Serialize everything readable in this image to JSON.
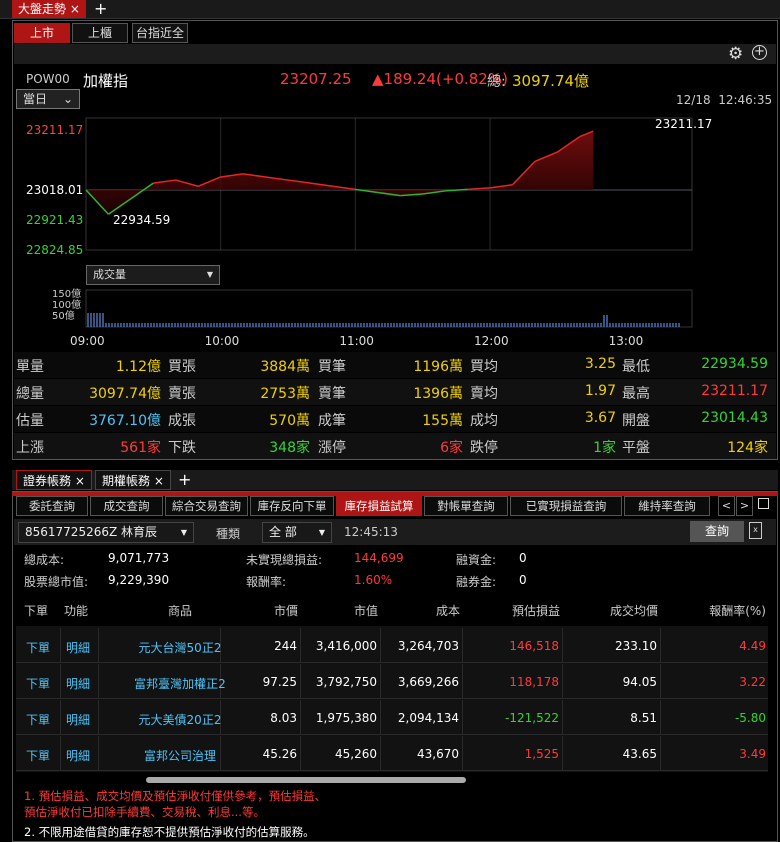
{
  "top_tab": {
    "label": "大盤走勢",
    "close": "×",
    "add": "+"
  },
  "market_tabs": [
    "上市",
    "上櫃",
    "台指近全"
  ],
  "index": {
    "code": "POW00",
    "name": "加權指",
    "price": "23207.25",
    "change": "▲189.24(+0.82%)",
    "total_label": "總:",
    "total": "3097.74億",
    "period": "當日",
    "datetime": "12/18  12:46:35"
  },
  "chart_data": {
    "type": "line",
    "y_ticks": [
      "23211.17",
      "23018.01",
      "22921.43",
      "22824.85"
    ],
    "x_ticks": [
      "09:00",
      "10:00",
      "11:00",
      "12:00",
      "13:00"
    ],
    "high_label": "23211.17",
    "low_label": "22934.59",
    "ref": "23018.01",
    "ylim": [
      22824.85,
      23211.17
    ],
    "x": [
      "09:00",
      "09:10",
      "09:20",
      "09:30",
      "09:40",
      "09:50",
      "10:00",
      "10:10",
      "10:20",
      "10:30",
      "10:40",
      "10:50",
      "11:00",
      "11:10",
      "11:20",
      "11:30",
      "11:40",
      "11:50",
      "12:00",
      "12:10",
      "12:20",
      "12:30",
      "12:40",
      "12:46"
    ],
    "values": [
      23018.01,
      22940,
      22990,
      23040,
      23050,
      23030,
      23060,
      23070,
      23060,
      23050,
      23040,
      23030,
      23020,
      23010,
      23000,
      23005,
      23015,
      23020,
      23025,
      23035,
      23110,
      23140,
      23190,
      23207.25
    ],
    "volume_select": "成交量",
    "volume_ticks": [
      "150億",
      "100億",
      "50億"
    ]
  },
  "stats": [
    [
      {
        "l": "單量",
        "v": "1.12億",
        "c": "yellow"
      },
      {
        "l": "買張",
        "v": "3884萬",
        "c": "yellow"
      },
      {
        "l": "買筆",
        "v": "1196萬",
        "c": "yellow"
      },
      {
        "l": "買均",
        "v": "3.25",
        "c": "yellow"
      },
      {
        "l": "最低",
        "v": "22934.59",
        "c": "green"
      }
    ],
    [
      {
        "l": "總量",
        "v": "3097.74億",
        "c": "yellow"
      },
      {
        "l": "賣張",
        "v": "2753萬",
        "c": "yellow"
      },
      {
        "l": "賣筆",
        "v": "1396萬",
        "c": "yellow"
      },
      {
        "l": "賣均",
        "v": "1.97",
        "c": "yellow"
      },
      {
        "l": "最高",
        "v": "23211.17",
        "c": "red"
      }
    ],
    [
      {
        "l": "估量",
        "v": "3767.10億",
        "c": "cyan"
      },
      {
        "l": "成張",
        "v": "570萬",
        "c": "yellow"
      },
      {
        "l": "成筆",
        "v": "155萬",
        "c": "yellow"
      },
      {
        "l": "成均",
        "v": "3.67",
        "c": "yellow"
      },
      {
        "l": "開盤",
        "v": "23014.43",
        "c": "green"
      }
    ],
    [
      {
        "l": "上漲",
        "v": "561家",
        "c": "red"
      },
      {
        "l": "下跌",
        "v": "348家",
        "c": "green"
      },
      {
        "l": "漲停",
        "v": "6家",
        "c": "red"
      },
      {
        "l": "跌停",
        "v": "1家",
        "c": "green"
      },
      {
        "l": "平盤",
        "v": "124家",
        "c": "yellow"
      }
    ]
  ],
  "bottom_tabs": [
    "證券帳務",
    "期權帳務"
  ],
  "sub_tabs": [
    "委託查詢",
    "成交查詢",
    "綜合交易查詢",
    "庫存反向下單",
    "庫存損益試算",
    "對帳單查詢",
    "已實現損益查詢",
    "維持率查詢"
  ],
  "account": {
    "id": "85617725266Z",
    "name": "林育辰",
    "type_label": "種類",
    "type_value": "全 部",
    "time": "12:45:13",
    "query": "查詢"
  },
  "summary": {
    "cost_l": "總成本:",
    "cost": "9,071,773",
    "unreal_l": "未實現總損益:",
    "unreal": "144,699",
    "fin_l": "融資金:",
    "fin": "0",
    "mv_l": "股票總市值:",
    "mv": "9,229,390",
    "rate_l": "報酬率:",
    "rate": "1.60%",
    "sec_l": "融券金:",
    "sec": "0"
  },
  "table": {
    "headers": [
      "下單",
      "功能",
      "商品",
      "市價",
      "市值",
      "成本",
      "預估損益",
      "成交均價",
      "報酬率(%)"
    ],
    "rows": [
      {
        "order": "下單",
        "func": "明細",
        "name": "元大台灣50正2",
        "price": "244",
        "mv": "3,416,000",
        "cost": "3,264,703",
        "pl": "146,518",
        "avg": "233.10",
        "rate": "4.49",
        "sign": "red"
      },
      {
        "order": "下單",
        "func": "明細",
        "name": "富邦臺灣加權正2",
        "price": "97.25",
        "mv": "3,792,750",
        "cost": "3,669,266",
        "pl": "118,178",
        "avg": "94.05",
        "rate": "3.22",
        "sign": "red"
      },
      {
        "order": "下單",
        "func": "明細",
        "name": "元大美債20正2",
        "price": "8.03",
        "mv": "1,975,380",
        "cost": "2,094,134",
        "pl": "-121,522",
        "avg": "8.51",
        "rate": "-5.80",
        "sign": "green"
      },
      {
        "order": "下單",
        "func": "明細",
        "name": "富邦公司治理",
        "price": "45.26",
        "mv": "45,260",
        "cost": "43,670",
        "pl": "1,525",
        "avg": "43.65",
        "rate": "3.49",
        "sign": "red"
      }
    ]
  },
  "notes": [
    "1. 預估損益、成交均價及預估淨收付僅供參考，預估損益、",
    "預估淨收付已扣除手續費、交易稅、利息...等。",
    "2. 不限用途借貸的庫存恕不提供預估淨收付的估算服務。"
  ]
}
